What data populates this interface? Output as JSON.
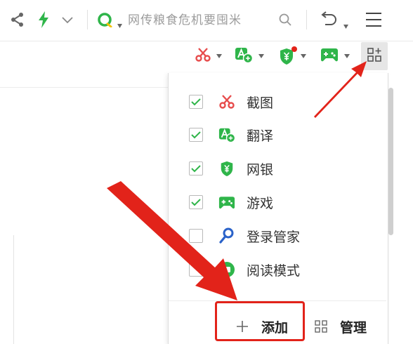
{
  "toolbar": {
    "search_placeholder": "网传粮食危机要囤米",
    "icons": [
      "share-icon",
      "bolt-icon",
      "chevron-down-icon",
      "search-engine-icon",
      "search-icon",
      "undo-icon",
      "menu-icon"
    ]
  },
  "extension_bar": {
    "icons": [
      "scissors-icon",
      "translate-icon",
      "shield-icon",
      "gamepad-icon",
      "grid-add-icon"
    ],
    "notification_dot_color": "#e2231a"
  },
  "panel": {
    "items": [
      {
        "label": "截图",
        "checked": true,
        "icon": "scissors-icon"
      },
      {
        "label": "翻译",
        "checked": true,
        "icon": "translate-icon"
      },
      {
        "label": "网银",
        "checked": true,
        "icon": "shield-icon"
      },
      {
        "label": "游戏",
        "checked": true,
        "icon": "gamepad-icon"
      },
      {
        "label": "登录管家",
        "checked": false,
        "icon": "key-icon"
      },
      {
        "label": "阅读模式",
        "checked": false,
        "icon": "reader-icon"
      }
    ],
    "add_label": "添加",
    "manage_label": "管理"
  },
  "colors": {
    "accent_green": "#2fb54a",
    "scissors_red": "#e74c4c",
    "key_blue": "#2a62c9",
    "annotation_red": "#e2231a"
  }
}
